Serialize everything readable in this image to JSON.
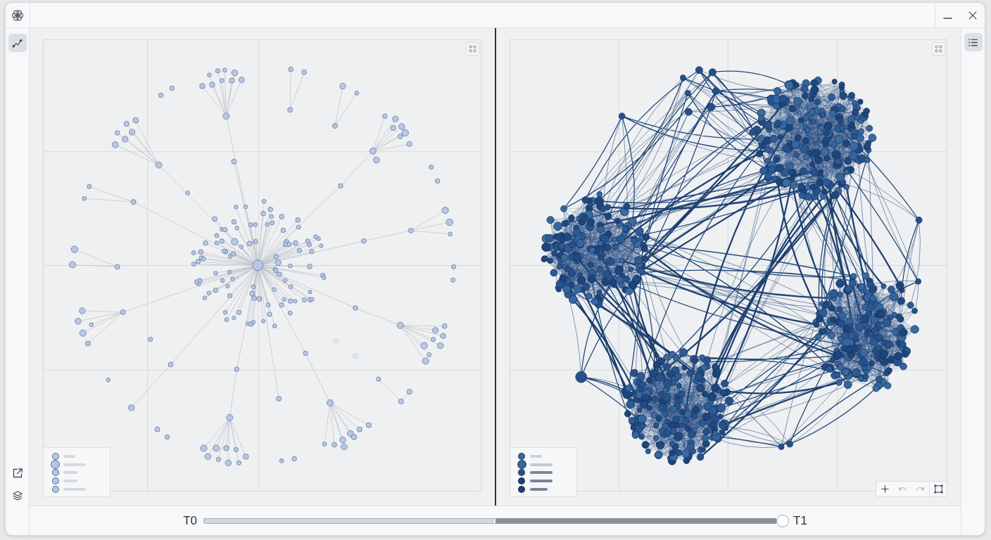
{
  "window": {
    "app_icon": {
      "kind": "flower"
    },
    "controls": [
      {
        "kind": "minimize"
      },
      {
        "kind": "close"
      }
    ]
  },
  "left_rail": {
    "top": [
      {
        "kind": "line-chart",
        "selected": true
      }
    ],
    "bottom": [
      {
        "kind": "external-link"
      },
      {
        "kind": "layers"
      }
    ]
  },
  "right_rail": {
    "items": [
      {
        "kind": "list",
        "selected": true
      }
    ]
  },
  "panels": [
    {
      "kind": "star",
      "fit_button": {
        "kind": "corners"
      },
      "legend": [
        {
          "kind": "small",
          "color": "#b3c6e6",
          "bar": {
            "kind": "short",
            "color": "#d5d9df"
          }
        },
        {
          "kind": "large",
          "color": "#b3c6e6",
          "bar": {
            "kind": "long",
            "color": "#d5d9df"
          }
        },
        {
          "kind": "small",
          "color": "#b3c6e6",
          "bar": {
            "kind": "medium",
            "color": "#d5d9df"
          }
        },
        {
          "kind": "small",
          "color": "#b3c6e6",
          "bar": {
            "kind": "medium",
            "color": "#d5d9df"
          }
        },
        {
          "kind": "small",
          "color": "#b3c6e6",
          "bar": {
            "kind": "long",
            "color": "#d5d9df"
          }
        }
      ]
    },
    {
      "kind": "clustered",
      "fit_button": {
        "kind": "corners"
      },
      "legend": [
        {
          "kind": "small",
          "color": "#3a6598",
          "bar": {
            "kind": "short",
            "color": "#cdd2d9"
          }
        },
        {
          "kind": "large",
          "color": "#3a6598",
          "bar": {
            "kind": "long",
            "color": "#c3c9d2"
          }
        },
        {
          "kind": "small",
          "color": "#2a5184",
          "bar": {
            "kind": "long",
            "color": "#7d889a"
          }
        },
        {
          "kind": "small",
          "color": "#1e4070",
          "bar": {
            "kind": "long",
            "color": "#76839a"
          }
        },
        {
          "kind": "small",
          "color": "#1e4070",
          "bar": {
            "kind": "wide",
            "color": "#7a8598"
          }
        }
      ],
      "toolbar": [
        {
          "kind": "plus",
          "disabled": false
        },
        {
          "kind": "undo",
          "disabled": true
        },
        {
          "kind": "redo",
          "disabled": true
        },
        {
          "kind": "frame",
          "disabled": false
        }
      ]
    }
  ],
  "timeline": {
    "start_label": "T0",
    "end_label": "T1",
    "split": {
      "level": 0.51
    },
    "thumb": {
      "level": 1
    }
  }
}
